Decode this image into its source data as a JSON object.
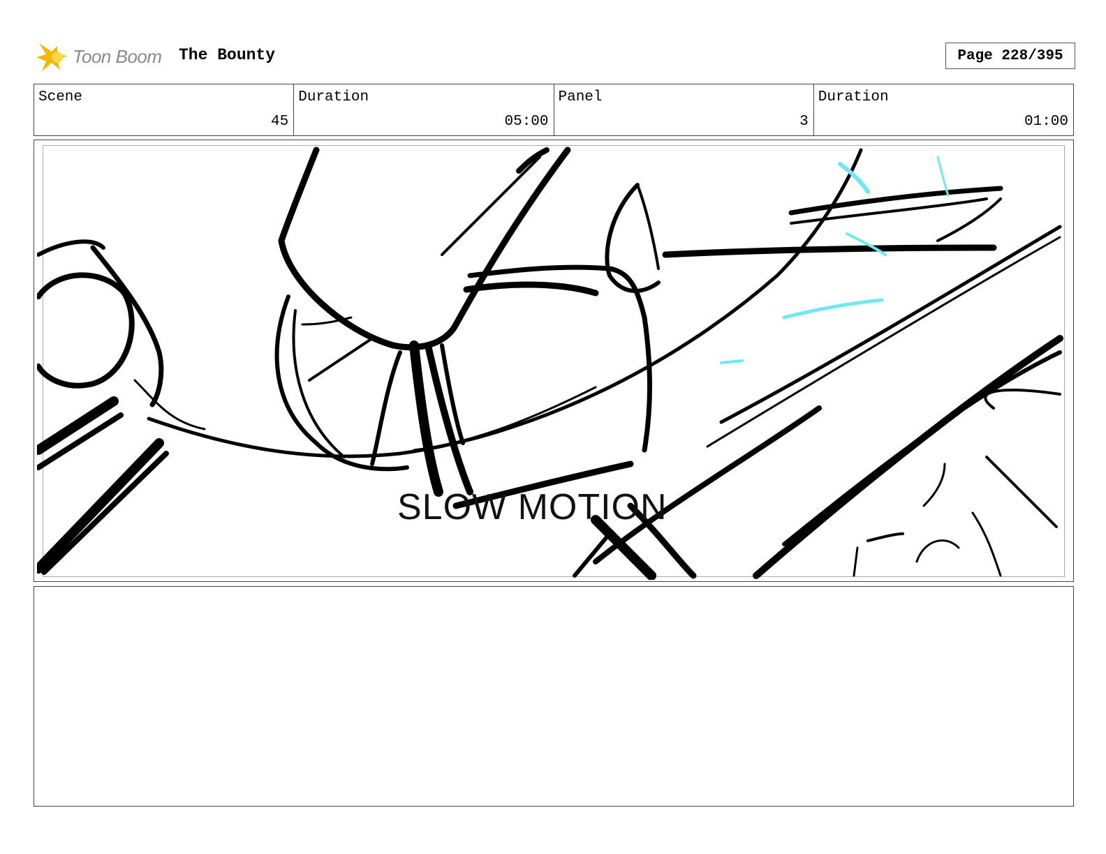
{
  "header": {
    "logo_text": "Toon Boom",
    "title": "The Bounty",
    "page_label": "Page 228/395"
  },
  "info": {
    "scene_label": "Scene",
    "scene_value": "45",
    "scene_duration_label": "Duration",
    "scene_duration_value": "05:00",
    "panel_label": "Panel",
    "panel_value": "3",
    "panel_duration_label": "Duration",
    "panel_duration_value": "01:00"
  },
  "panel": {
    "overlay_text": "SLOW MOTION"
  },
  "colors": {
    "sketch_ink": "#000000",
    "highlight": "#6ee9f2",
    "logo_star": "#f5b800"
  },
  "notes": {}
}
